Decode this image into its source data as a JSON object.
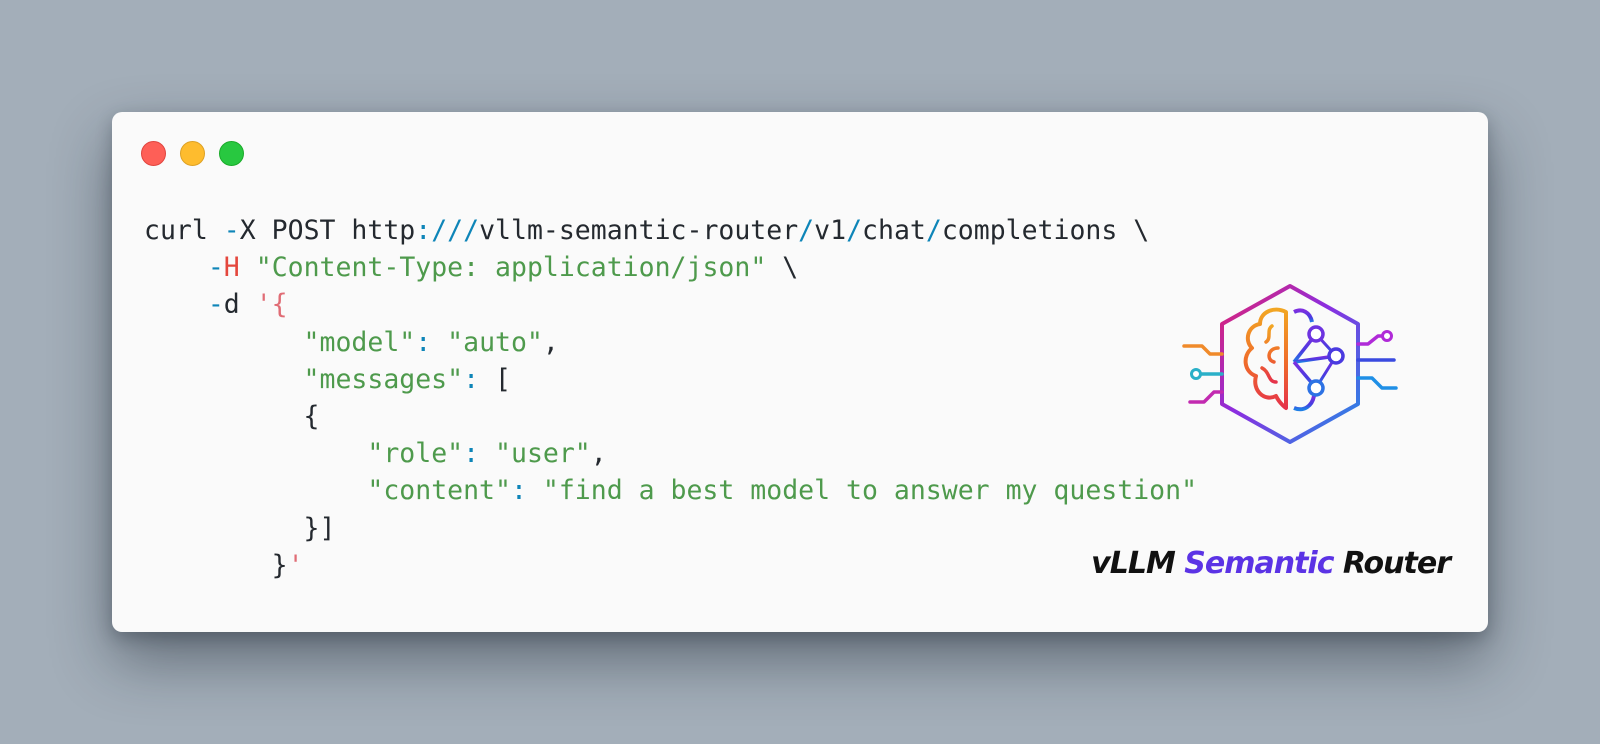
{
  "window": {
    "traffic_lights": {
      "close": {
        "icon": "close-dot-icon",
        "color": "#fe5f57"
      },
      "minimize": {
        "icon": "minimize-dot-icon",
        "color": "#febc2e"
      },
      "maximize": {
        "icon": "maximize-dot-icon",
        "color": "#28c840"
      }
    }
  },
  "code": {
    "lines": [
      [
        {
          "text": "curl ",
          "kind": "plain"
        },
        {
          "text": "-",
          "kind": "op"
        },
        {
          "text": "X POST http",
          "kind": "plain"
        },
        {
          "text": ":///",
          "kind": "op"
        },
        {
          "text": "vllm-semantic-router",
          "kind": "plain"
        },
        {
          "text": "/",
          "kind": "op"
        },
        {
          "text": "v1",
          "kind": "plain"
        },
        {
          "text": "/",
          "kind": "op"
        },
        {
          "text": "chat",
          "kind": "plain"
        },
        {
          "text": "/",
          "kind": "op"
        },
        {
          "text": "completions \\",
          "kind": "plain"
        }
      ],
      [
        {
          "text": "    ",
          "kind": "plain"
        },
        {
          "text": "-",
          "kind": "op"
        },
        {
          "text": "H",
          "kind": "flag"
        },
        {
          "text": " ",
          "kind": "plain"
        },
        {
          "text": "\"Content-Type: application/json\"",
          "kind": "str"
        },
        {
          "text": " \\",
          "kind": "plain"
        }
      ],
      [
        {
          "text": "    ",
          "kind": "plain"
        },
        {
          "text": "-",
          "kind": "op"
        },
        {
          "text": "d ",
          "kind": "plain"
        },
        {
          "text": "'{",
          "kind": "quote"
        }
      ],
      [
        {
          "text": "          ",
          "kind": "plain"
        },
        {
          "text": "\"model\"",
          "kind": "str"
        },
        {
          "text": ": ",
          "kind": "op"
        },
        {
          "text": "\"auto\"",
          "kind": "str"
        },
        {
          "text": ",",
          "kind": "plain"
        }
      ],
      [
        {
          "text": "          ",
          "kind": "plain"
        },
        {
          "text": "\"messages\"",
          "kind": "str"
        },
        {
          "text": ": ",
          "kind": "op"
        },
        {
          "text": "[",
          "kind": "plain"
        }
      ],
      [
        {
          "text": "          {",
          "kind": "plain"
        }
      ],
      [
        {
          "text": "              ",
          "kind": "plain"
        },
        {
          "text": "\"role\"",
          "kind": "str"
        },
        {
          "text": ": ",
          "kind": "op"
        },
        {
          "text": "\"user\"",
          "kind": "str"
        },
        {
          "text": ",",
          "kind": "plain"
        }
      ],
      [
        {
          "text": "              ",
          "kind": "plain"
        },
        {
          "text": "\"content\"",
          "kind": "str"
        },
        {
          "text": ": ",
          "kind": "op"
        },
        {
          "text": "\"find a best model to answer my question\"",
          "kind": "str"
        }
      ],
      [
        {
          "text": "          }]",
          "kind": "plain"
        }
      ],
      [
        {
          "text": "        }",
          "kind": "plain"
        },
        {
          "text": "'",
          "kind": "quote"
        }
      ]
    ]
  },
  "brand": {
    "part1": "vLLM ",
    "part2": "Semantic",
    "part3": " Router",
    "accent_color": "#5b33e5",
    "logo_icon": "brain-circuit-hexagon-logo-icon"
  }
}
